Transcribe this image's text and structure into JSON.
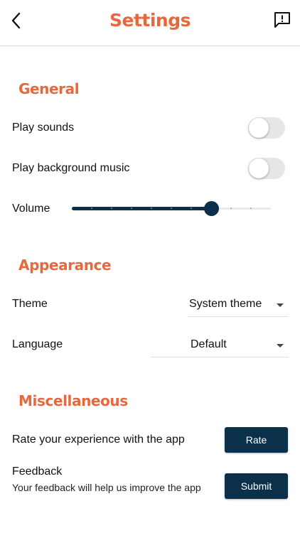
{
  "header": {
    "title": "Settings",
    "back_icon": "chevron-left-icon",
    "report_icon": "feedback-icon"
  },
  "general": {
    "title": "General",
    "play_sounds": {
      "label": "Play sounds",
      "enabled": false
    },
    "play_music": {
      "label": "Play background music",
      "enabled": false
    },
    "volume": {
      "label": "Volume",
      "value": 0.7,
      "steps": 10
    }
  },
  "appearance": {
    "title": "Appearance",
    "theme": {
      "label": "Theme",
      "value": "System theme"
    },
    "language": {
      "label": "Language",
      "value": "Default"
    }
  },
  "misc": {
    "title": "Miscellaneous",
    "rate": {
      "label": "Rate your experience with the app",
      "button": "Rate"
    },
    "feedback": {
      "label": "Feedback",
      "description": "Your feedback will help us improve the app",
      "button": "Submit"
    }
  },
  "colors": {
    "accent": "#e8683e",
    "primary": "#0b3049",
    "toggle_off": "#e6e6e6"
  }
}
